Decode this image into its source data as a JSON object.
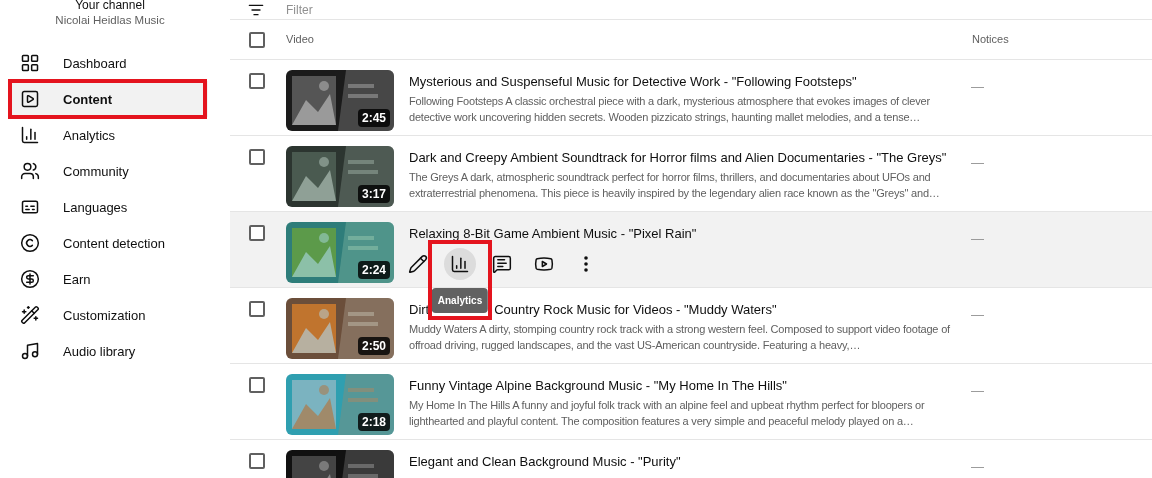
{
  "channel": {
    "label": "Your channel",
    "name": "Nicolai Heidlas Music"
  },
  "sidebar": {
    "items": [
      {
        "label": "Dashboard",
        "selected": false,
        "outlined": false
      },
      {
        "label": "Content",
        "selected": true,
        "outlined": true
      },
      {
        "label": "Analytics",
        "selected": false,
        "outlined": false
      },
      {
        "label": "Community",
        "selected": false,
        "outlined": false
      },
      {
        "label": "Languages",
        "selected": false,
        "outlined": false
      },
      {
        "label": "Content detection",
        "selected": false,
        "outlined": false
      },
      {
        "label": "Earn",
        "selected": false,
        "outlined": false
      },
      {
        "label": "Customization",
        "selected": false,
        "outlined": false
      },
      {
        "label": "Audio library",
        "selected": false,
        "outlined": false
      }
    ]
  },
  "filter": {
    "placeholder": "Filter"
  },
  "table": {
    "columns": [
      "Video",
      "Notices"
    ],
    "select_all": {
      "checked": false
    },
    "rows": [
      {
        "title": "Mysterious and Suspenseful Music for Detective Work - \"Following Footsteps\"",
        "description": "Following Footsteps A classic orchestral piece with a dark, mysterious atmosphere that evokes images of clever detective work uncovering hidden secrets. Wooden pizzicato strings, haunting mallet melodies, and a tense…",
        "duration": "2:45",
        "notices": "—",
        "hovered": false,
        "checked": false
      },
      {
        "title": "Dark and Creepy Ambient Soundtrack for Horror films and Alien Documentaries - \"The Greys\"",
        "description": "The Greys A dark, atmospheric soundtrack perfect for horror films, thrillers, and documentaries about UFOs and extraterrestrial phenomena. This piece is heavily inspired by the legendary alien race known as the \"Greys\" and…",
        "duration": "3:17",
        "notices": "—",
        "hovered": false,
        "checked": false
      },
      {
        "title": "Relaxing 8-Bit Game Ambient Music - \"Pixel Rain\"",
        "duration": "2:24",
        "notices": "—",
        "hovered": true,
        "checked": false,
        "actions": [
          {
            "kind": "edit",
            "focused": false,
            "outlined": false
          },
          {
            "kind": "analytics",
            "focused": true,
            "outlined": true,
            "tooltip": "Analytics"
          },
          {
            "kind": "comments",
            "focused": false,
            "outlined": false
          },
          {
            "kind": "watch",
            "focused": false,
            "outlined": false
          },
          {
            "kind": "more",
            "focused": false,
            "outlined": false
          }
        ]
      },
      {
        "title_segments": [
          "Dirt",
          "Country Rock Music for Videos - \"Muddy Waters\""
        ],
        "description": "Muddy Waters A dirty, stomping country rock track with a strong western feel. Composed to support video footage of offroad driving, rugged landscapes, and the vast US-American countryside. Featuring a heavy,…",
        "duration": "2:50",
        "notices": "—",
        "hovered": false,
        "checked": false
      },
      {
        "title": "Funny Vintage Alpine Background Music - \"My Home In The Hills\"",
        "description": "My Home In The Hills A funny and joyful folk track with an alpine feel and upbeat rhythm perfect for bloopers or lighthearted and playful content. The composition features a very simple and peaceful melody played on a…",
        "duration": "2:18",
        "notices": "—",
        "hovered": false,
        "checked": false
      },
      {
        "title": "Elegant and Clean Background Music - \"Purity\"",
        "notices": "—",
        "hovered": false,
        "checked": false
      }
    ]
  }
}
